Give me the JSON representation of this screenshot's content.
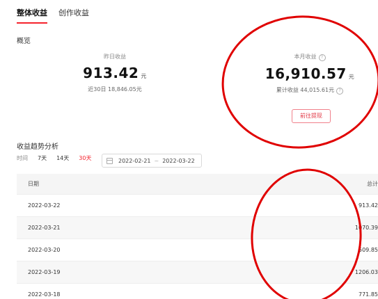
{
  "tabs": [
    {
      "label": "整体收益",
      "active": true
    },
    {
      "label": "创作收益",
      "active": false
    }
  ],
  "overview": {
    "title": "概览",
    "yesterday": {
      "label": "昨日收益",
      "value": "913.42",
      "unit": "元",
      "sub": "近30日 18,846.05元"
    },
    "month": {
      "label": "本月收益",
      "value": "16,910.57",
      "unit": "元",
      "sub": "累计收益 44,015.61元",
      "help_icon": "?"
    },
    "withdraw_label": "前往提现"
  },
  "trend": {
    "title": "收益趋势分析",
    "time_label": "时间",
    "options": [
      "7天",
      "14天",
      "30天"
    ],
    "active_option": "30天",
    "date_start": "2022-02-21",
    "date_sep": "~",
    "date_end": "2022-03-22"
  },
  "table": {
    "headers": {
      "date": "日期",
      "total": "总计"
    },
    "rows": [
      {
        "date": "2022-03-22",
        "total": "913.42"
      },
      {
        "date": "2022-03-21",
        "total": "1070.39"
      },
      {
        "date": "2022-03-20",
        "total": "509.85"
      },
      {
        "date": "2022-03-19",
        "total": "1206.03"
      },
      {
        "date": "2022-03-18",
        "total": "771.85"
      }
    ]
  },
  "colors": {
    "accent": "#f5222d",
    "annotation": "#e00000"
  }
}
